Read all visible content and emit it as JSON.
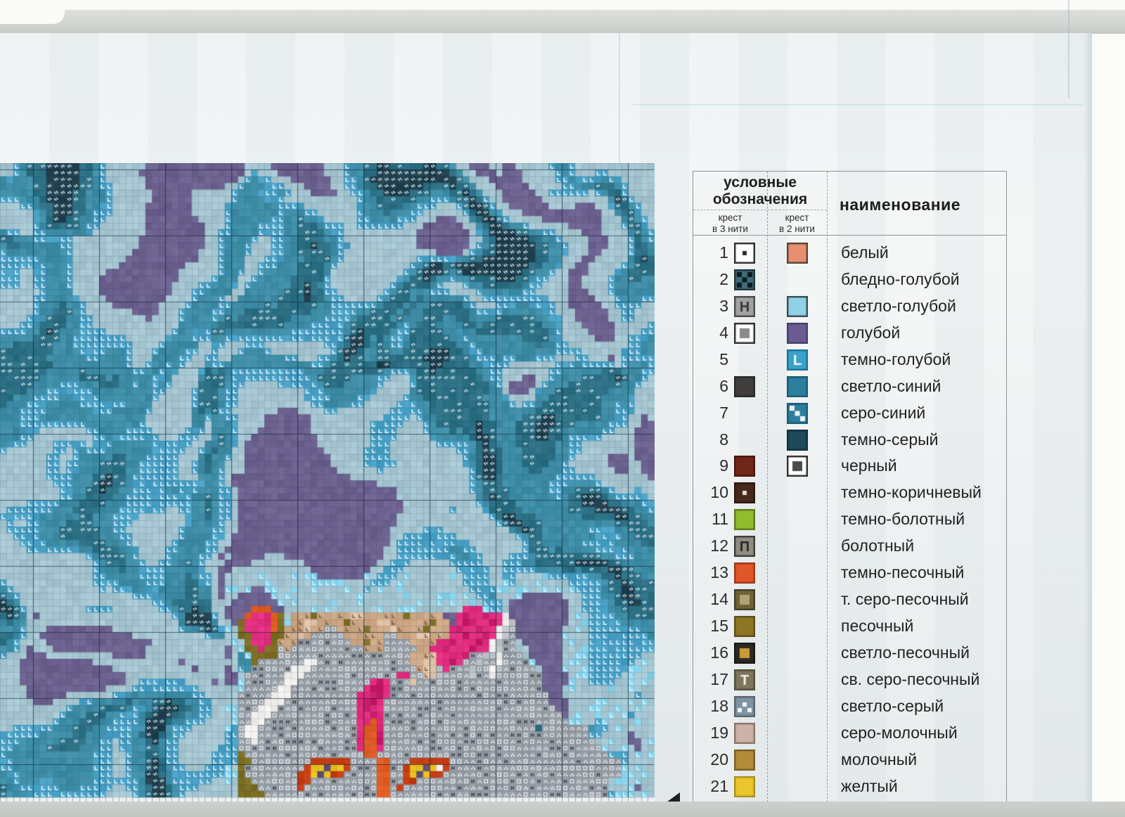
{
  "legend": {
    "header": {
      "title1": "условные",
      "title2": "обозначения",
      "col3_line1": "крест",
      "col3_line2": "в 3 нити",
      "col2_line1": "крест",
      "col2_line2": "в 2 нити",
      "name_header": "наименование"
    },
    "rows": [
      {
        "num": "1",
        "name": "белый",
        "sym3": {
          "bg": "#ffffff",
          "border": "#2a2a2a",
          "glyph": "dot",
          "gc": "#2a2a2a"
        },
        "sym2": {
          "bg": "#e79070",
          "border": "#5a4038"
        }
      },
      {
        "num": "2",
        "name": "бледно-голубой",
        "sym3": {
          "bg": "#3d6d7a",
          "border": "#22343a",
          "glyph": "checker",
          "gc": "#10181a"
        },
        "sym2": null
      },
      {
        "num": "3",
        "name": "светло-голубой",
        "sym3": {
          "bg": "#a2a2a0",
          "border": "#4a4a48",
          "glyph": "H",
          "gc": "#38383a"
        },
        "sym2": {
          "bg": "#8fd2e8",
          "border": "#3a4a50"
        }
      },
      {
        "num": "4",
        "name": "голубой",
        "sym3": {
          "bg": "#fbfbfb",
          "border": "#2a2a2a",
          "glyph": "insq",
          "gc": "#8a8a8a"
        },
        "sym2": {
          "bg": "#6a5c92",
          "border": "#46406a"
        }
      },
      {
        "num": "5",
        "name": "темно-голубой",
        "sym3": null,
        "sym2": {
          "bg": "#38a2cc",
          "border": "#1d7296",
          "glyph": "L",
          "gc": "#ffffff"
        }
      },
      {
        "num": "6",
        "name": "светло-синий",
        "sym3": {
          "bg": "#403e3c",
          "border": "#2a2a2a"
        },
        "sym2": {
          "bg": "#2b7e9e",
          "border": "#1c5a72"
        }
      },
      {
        "num": "7",
        "name": "серо-синий",
        "sym3": null,
        "sym2": {
          "bg": "#2b7e9e",
          "border": "#1c5a72",
          "glyph": "steps",
          "gc": "#f2f6f6"
        }
      },
      {
        "num": "8",
        "name": "темно-серый",
        "sym3": null,
        "sym2": {
          "bg": "#1e4a5c",
          "border": "#12303c"
        }
      },
      {
        "num": "9",
        "name": "черный",
        "sym3": {
          "bg": "#702618",
          "border": "#4a180e"
        },
        "sym2": {
          "bg": "#ffffff",
          "border": "#2a2a2a",
          "glyph": "insq",
          "gc": "#4a4a4a"
        }
      },
      {
        "num": "10",
        "name": "темно-коричневый",
        "sym3": {
          "bg": "#46281c",
          "border": "#2e180e",
          "glyph": "dot",
          "gc": "#e8e0d8"
        },
        "sym2": null
      },
      {
        "num": "11",
        "name": "темно-болотный",
        "sym3": {
          "bg": "#92bc2c",
          "border": "#5c7a1a"
        },
        "sym2": null
      },
      {
        "num": "12",
        "name": "болотный",
        "sym3": {
          "bg": "#8e8e84",
          "border": "#3c3c34",
          "glyph": "P",
          "gc": "#28281e"
        },
        "sym2": null
      },
      {
        "num": "13",
        "name": "темно-песочный",
        "sym3": {
          "bg": "#e05628",
          "border": "#a03618"
        },
        "sym2": null
      },
      {
        "num": "14",
        "name": "т. серо-песочный",
        "sym3": {
          "bg": "#6e6236",
          "border": "#46402a",
          "glyph": "insq",
          "gc": "#b2a374"
        },
        "sym2": null
      },
      {
        "num": "15",
        "name": "песочный",
        "sym3": {
          "bg": "#8c7524",
          "border": "#5e4e16"
        },
        "sym2": null
      },
      {
        "num": "16",
        "name": "светло-песочный",
        "sym3": {
          "bg": "#2c2824",
          "border": "#1a1816",
          "glyph": "insq",
          "gc": "#c89c34"
        },
        "sym2": null
      },
      {
        "num": "17",
        "name": "св. серо-песочный",
        "sym3": {
          "bg": "#7e755a",
          "border": "#544e3a",
          "glyph": "T",
          "gc": "#f4f4f0"
        },
        "sym2": null
      },
      {
        "num": "18",
        "name": "светло-серый",
        "sym3": {
          "bg": "#7e94a2",
          "border": "#54646e",
          "glyph": "tridots",
          "gc": "#f4f6f6"
        },
        "sym2": null
      },
      {
        "num": "19",
        "name": "серо-молочный",
        "sym3": {
          "bg": "#ccb2a6",
          "border": "#8a7468"
        },
        "sym2": null
      },
      {
        "num": "20",
        "name": "молочный",
        "sym3": {
          "bg": "#b28c3a",
          "border": "#7a5e24"
        },
        "sym2": null
      },
      {
        "num": "21",
        "name": "желтый",
        "sym3": {
          "bg": "#e8c62c",
          "border": "#a8901c"
        },
        "sym2": null
      }
    ]
  },
  "chart": {
    "water": {
      "seed": 1377,
      "cols": 99,
      "rows": 96,
      "cell": 9.4,
      "colors": {
        "purple": "#6d6190",
        "pale": "#a6c6d2",
        "medium": "#47a0c6",
        "teal": "#3f8ea8",
        "darkteal": "#2c7085",
        "navy": "#20404f",
        "sky": "#84d2ec"
      },
      "thresholds": [
        0.365,
        0.509,
        0.573,
        0.641,
        0.71
      ],
      "mark_color": "#ddf0f8"
    },
    "tiger": {
      "col0": 36,
      "row0": 66,
      "colors": {
        "T": "#cfa886",
        "B": "#e3c6aa",
        "V": "#7d6f22",
        "E": "#e52d80",
        "e": "#c81a6a",
        "O": "#e05a20",
        "G": "#9aa1a9",
        "W": "#f0efed",
        "g": "#c2c6cb",
        "K": "#2e6e84",
        "P": "#5c4b72",
        "Y": "#e8bf1e",
        "R": "#c63b10"
      },
      "rows": [
        "...............................................................",
        "..OOO.............................EEE..........................",
        ".OEEEOV.TTTVTTTTTBBTTTTTTVTTTTT..EeEEeEEW......................",
        "VEEEEOV.TTBBTTTTVTTTTBBTTTTTTVTT.EeeEEeEWg.....................",
        "VEEEEOVTTTBTTGGTTTTVTTTBTTTTVTTTEeEEeEEWgG.....................",
        "VVEEEVVTTBTGGGGGTTTTTTGGTTTBBTTTEEeEEeEWgG.....................",
        ".VEEEVTTTGGGGGGGGTTVTTGGGGTTTTEEeEEEeEWgGG.....................",
        ".VVEVVGTGGGGGGGGGGGTTTGGGGGTTEEeEEEeEEWgGG.....................",
        "..VVVVGGGGGGGGGGGGGGGGGGGGTTTBEEEEeGGgGWGGG....................",
        "..VGGGGGGGWWGGGGGGGGGGGGGGTTBBEEeEGGgGGWGGGG...................",
        "..GGGGGGWWWGGGGGGGGGGGGGGGGTBBGEGGGgGGWGGGGGG..................",
        ".GGGGGGWWWGGGGGGGGGGGGGGEEGGBBGGGGGgGGWGGGGGGG.................",
        ".GGGGGGWWGGGGGGGGGGGEeEGGGBGGGGGGGGGGGGGGGGGGG.................",
        ".GGGGGWWGGGGGGGGGGGEeeEGGGGGGGGGGGGGGGGGGGGGGG................",
        "GGGGGWWWGGGGGGGGGGEEeeEGGGGGGGGGGGGGGGGGGGGGGGG...............",
        "GGGGWWWGGGGGGGGGGGEeeEGGGGGGGGGGGGGGGGGGGGGGGGG..............",
        "GGGWWWGGGGGGGGGGGGEeEEGGGGGGGGGGGGGGGGGGGGGGGGGG.............",
        "GGWWWGGGGGGGGGGGGGEEeEGGGGGGGGGGGGGGGGGGGGGGGGGGG............",
        "GGWWGGGGGGGGGGGGGGEEOEGGGGGGGGGGGGGGGGGGGGGGGGGGGG...........",
        "GWWGGGGGGGGGGGGGGGEOOEGGGGGGGGGGGGGGGGGGGGGGGKGGGGGGG..........",
        "GWWGGGGGGGGGGGGGGGEOOeGGGGGGGGGGGGGGGGGGGGGGGGGGGGGGG.........",
        "GGWGGGGGGGGGGGGGGGEOOeGGGGGGGGGGGGGGGGGGGGGGGGGGGGGGGG........",
        "GGGGGGGGGGGGGGGGGGEOOEGGGGGGGGGGGGGGGGGGGGGGGGGGGGGGGGG.......",
        "VGGGGGGGGGGGGGGGGGGOOGGGGGGGGGGGGGGGGGGGGGGGGGGGGGGGGGGG......",
        "VVGGGGGGGGGRRRRRRGGGGOOGGGRRRRRRGGGGGGGGGGGGGGGGGGGGGGGGGG....",
        "VGGGGGGGGGRYYPYYRGGGGOOGGRYYPYWRGGGGGGGGGGGGGGGGGGGGGGGGGG....",
        "VGGGGGGGGRRYPYRRGGGGGOOGGRYPYRRGGGGGGGGGGGGGGGGGGGGGGGGGGG....",
        "VVGGGGGGGRRGGGGGGGGGGOOGGRRGGGGGGGGGGGGGGGGGGGGGGGGGGGGG......",
        "VVVGGGGGGRGGGGGGGGGGGOOGRGGGGGGGGGGGGGGGGGGGGGGGGGGGGGGG......",
        "VVVVGGGGGGGGGGGGGGGGGOOGGGGGGGGGGGGGGGGGGGGGGGGGGGGGGGGG......"
      ]
    }
  }
}
